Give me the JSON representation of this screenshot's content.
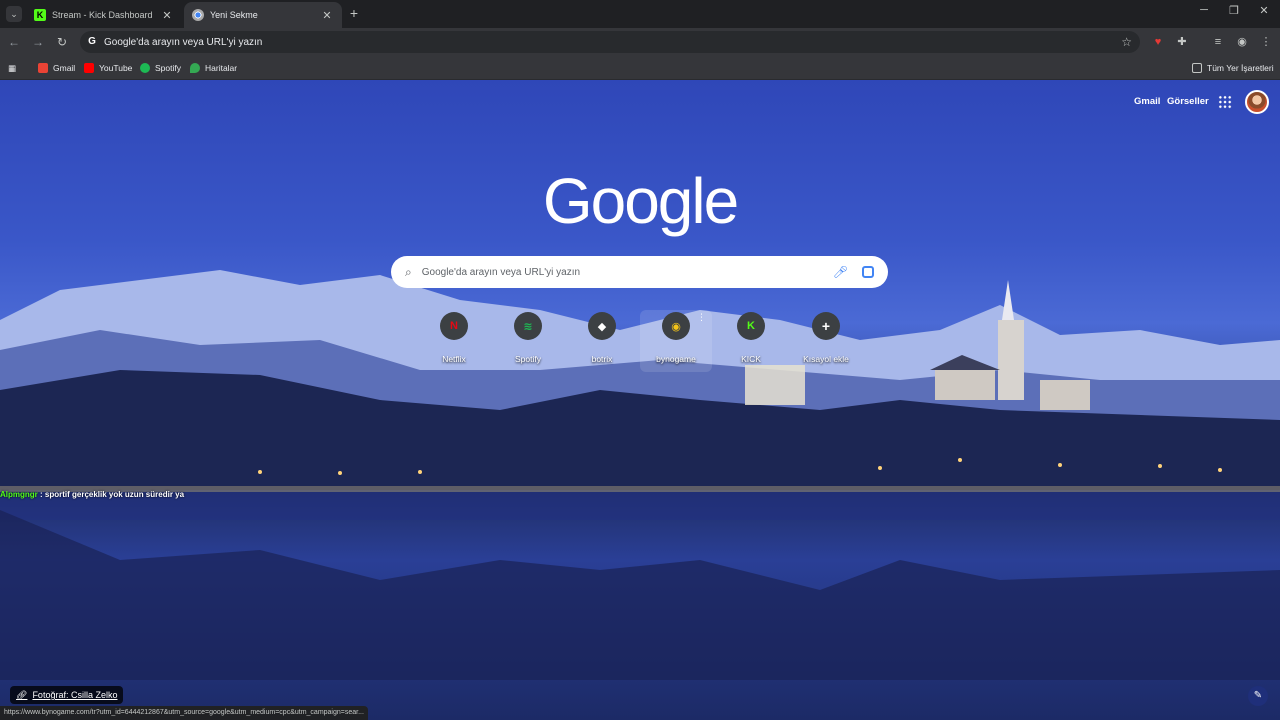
{
  "tabs": [
    {
      "title": "Stream - Kick Dashboard",
      "active": false
    },
    {
      "title": "Yeni Sekme",
      "active": true
    }
  ],
  "omnibox": {
    "text": "Google'da arayın veya URL'yi yazın"
  },
  "bookmarks": {
    "items": [
      {
        "label": "Gmail",
        "color": "#ea4335"
      },
      {
        "label": "YouTube",
        "color": "#ff0000"
      },
      {
        "label": "Spotify",
        "color": "#1db954"
      },
      {
        "label": "Haritalar",
        "color": "#34a853"
      }
    ],
    "all_label": "Tüm Yer İşaretleri"
  },
  "ntp": {
    "header": {
      "gmail": "Gmail",
      "images": "Görseller"
    },
    "logo": "Google",
    "search_placeholder": "Google'da arayın veya URL'yi yazın",
    "shortcuts": [
      {
        "label": "Netflix",
        "glyph": "N",
        "color": "#e50914"
      },
      {
        "label": "Spotify",
        "glyph": "≋",
        "color": "#1db954"
      },
      {
        "label": "botrix",
        "glyph": "◆",
        "color": "#ffffff"
      },
      {
        "label": "bynogame",
        "glyph": "◉",
        "color": "#f5c518"
      },
      {
        "label": "KICK",
        "glyph": "K",
        "color": "#53fc18"
      },
      {
        "label": "Kısayol ekle",
        "glyph": "+",
        "color": "#ffffff"
      }
    ],
    "chat_overlay": {
      "name": "Alpmgngr",
      "message": " : sportif gerçeklik yok uzun süredir ya"
    },
    "photo_credit": "Fotoğraf: Csilla Zelko",
    "status_url": "https://www.bynogame.com/tr?utm_id=6444212867&utm_source=google&utm_medium=cpc&utm_campaign=sear..."
  }
}
